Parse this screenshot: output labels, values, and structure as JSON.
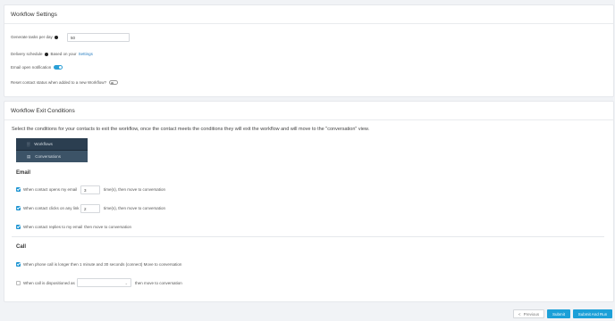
{
  "settings": {
    "title": "Workflow Settings",
    "generate_label": "Generate  tasks per day",
    "generate_value": "50",
    "delivery_label": "Delivery schedule",
    "delivery_prefix": "Based on your",
    "delivery_link": "Settings",
    "email_open_label": "Email open notification",
    "email_open_on": true,
    "reset_label": "Reset contact status when added to a new Workflow?",
    "reset_on": false
  },
  "exit": {
    "title": "Workflow Exit Conditions",
    "description": "Select the conditions for your contacts to exit the workflow, once the contact meets the conditions they will exit the workflow and will move to the \"conversation\" view.",
    "nav": [
      {
        "label": "Workflows",
        "icon": "chart-icon",
        "glyph": "░"
      },
      {
        "label": "Conversations",
        "icon": "chat-icon",
        "glyph": "▤"
      }
    ],
    "email_title": "Email",
    "opens_label": "When contact opens my email",
    "opens_value": "3",
    "opens_suffix": "time(s), then move to conversation",
    "clicks_label": "When contact clicks on any link",
    "clicks_value": "2",
    "clicks_suffix": "time(s), then move to conversation",
    "replies_label": "When contact replies to my email",
    "replies_suffix": "then move to conversation",
    "call_title": "Call",
    "phone_label": "When phone call is longer then 1 minute and 30 seconds (connect) Move to conversation",
    "disposition_label": "When call is dispositioned as",
    "disposition_suffix": "then move to conversation"
  },
  "footer": {
    "previous": "Previous",
    "previous_glyph": "<",
    "submit": "Submit",
    "submit_run": "Submit And Run"
  },
  "colors": {
    "accent": "#1ca0d8",
    "nav_bg": "#2b3e50"
  }
}
